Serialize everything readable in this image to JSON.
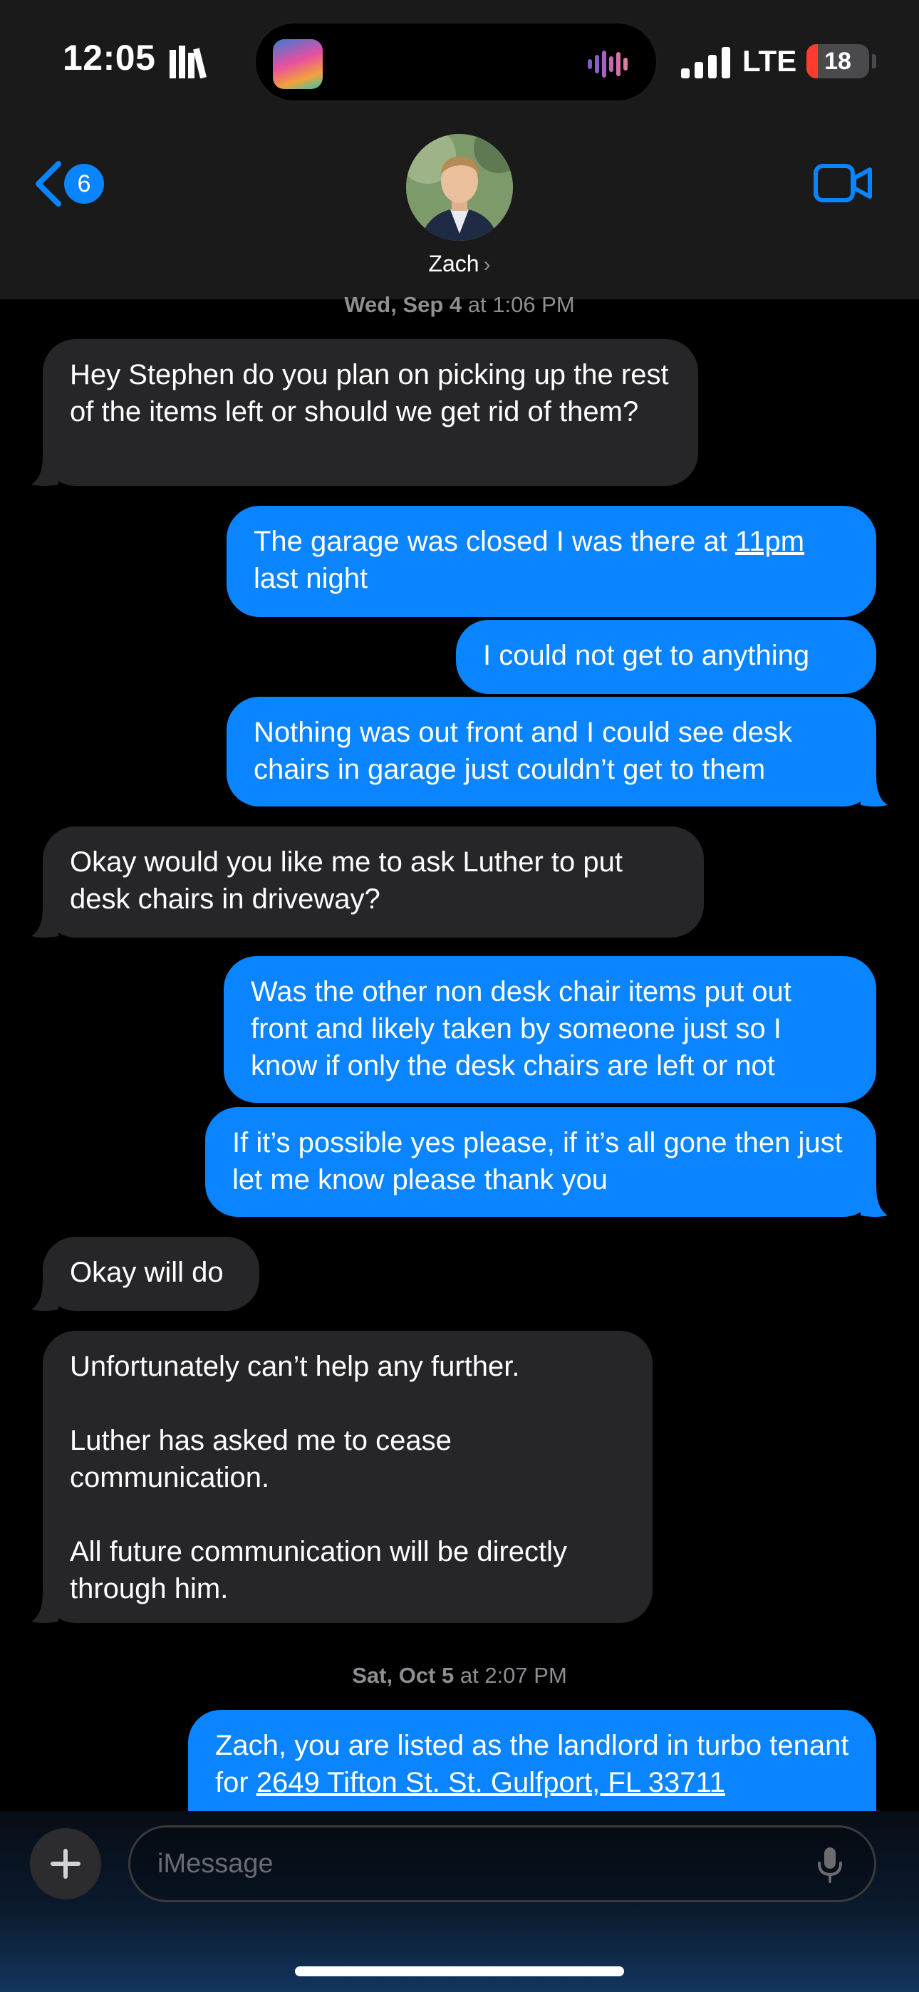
{
  "status": {
    "time": "12:05",
    "network": "LTE",
    "battery": "18",
    "battery_level": 0.18
  },
  "header": {
    "back_count": "6",
    "contact_name": "Zach",
    "contact_chevron": "›"
  },
  "conversation": {
    "timestamp1_day": "Wed, Sep 4",
    "timestamp1_time": " at 1:06 PM",
    "m1": "Hey Stephen do you plan on picking up the rest of the items left or should we get rid of them?",
    "m2_a": "The garage was closed I was there at ",
    "m2_link": "11pm",
    "m2_b": " last night",
    "m3": "I could not get to anything",
    "m4": "Nothing was out front and I could see desk chairs in garage just couldn’t get to them",
    "m5": "Okay would you like me to ask Luther to put desk chairs in driveway?",
    "m6": "Was the other non desk chair items put out front and likely taken by someone just so I know if only the desk chairs are left or not",
    "m7": "If it’s possible yes please, if it’s all gone then just let me know please thank you",
    "m8": "Okay will do",
    "m9": "Unfortunately can’t help any further.\n\nLuther has asked me to cease communication.\n\nAll future communication will be directly through him.",
    "timestamp2_day": "Sat, Oct 5",
    "timestamp2_time": " at 2:07 PM",
    "m10_a": "Zach, you are listed as the landlord in turbo tenant for ",
    "m10_link": "2649 Tifton St. St. Gulfport, FL 33711"
  },
  "input": {
    "placeholder": "iMessage"
  }
}
